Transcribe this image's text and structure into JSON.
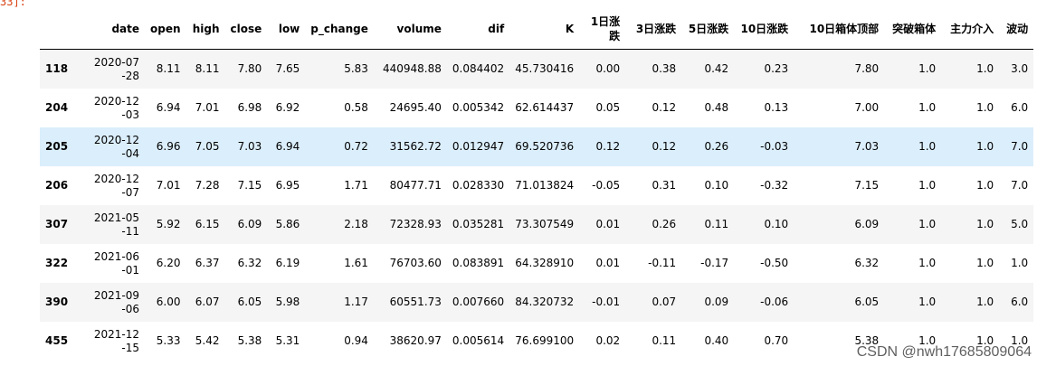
{
  "cell_prompt": "33]:",
  "table": {
    "index_header": "",
    "columns": [
      "date",
      "open",
      "high",
      "close",
      "low",
      "p_change",
      "volume",
      "dif",
      "K",
      "1日涨跌",
      "3日涨跌",
      "5日涨跌",
      "10日涨跌",
      "10日箱体顶部",
      "突破箱体",
      "主力介入",
      "波动"
    ],
    "rows": [
      {
        "index": "118",
        "cells": [
          "2020-07-28",
          "8.11",
          "8.11",
          "7.80",
          "7.65",
          "5.83",
          "440948.88",
          "0.084402",
          "45.730416",
          "0.00",
          "0.38",
          "0.42",
          "0.23",
          "7.80",
          "1.0",
          "1.0",
          "3.0"
        ]
      },
      {
        "index": "204",
        "cells": [
          "2020-12-03",
          "6.94",
          "7.01",
          "6.98",
          "6.92",
          "0.58",
          "24695.40",
          "0.005342",
          "62.614437",
          "0.05",
          "0.12",
          "0.48",
          "0.13",
          "7.00",
          "1.0",
          "1.0",
          "6.0"
        ]
      },
      {
        "index": "205",
        "cells": [
          "2020-12-04",
          "6.96",
          "7.05",
          "7.03",
          "6.94",
          "0.72",
          "31562.72",
          "0.012947",
          "69.520736",
          "0.12",
          "0.12",
          "0.26",
          "-0.03",
          "7.03",
          "1.0",
          "1.0",
          "7.0"
        ]
      },
      {
        "index": "206",
        "cells": [
          "2020-12-07",
          "7.01",
          "7.28",
          "7.15",
          "6.95",
          "1.71",
          "80477.71",
          "0.028330",
          "71.013824",
          "-0.05",
          "0.31",
          "0.10",
          "-0.32",
          "7.15",
          "1.0",
          "1.0",
          "7.0"
        ]
      },
      {
        "index": "307",
        "cells": [
          "2021-05-11",
          "5.92",
          "6.15",
          "6.09",
          "5.86",
          "2.18",
          "72328.93",
          "0.035281",
          "73.307549",
          "0.01",
          "0.26",
          "0.11",
          "0.10",
          "6.09",
          "1.0",
          "1.0",
          "5.0"
        ]
      },
      {
        "index": "322",
        "cells": [
          "2021-06-01",
          "6.20",
          "6.37",
          "6.32",
          "6.19",
          "1.61",
          "76703.60",
          "0.083891",
          "64.328910",
          "0.01",
          "-0.11",
          "-0.17",
          "-0.50",
          "6.32",
          "1.0",
          "1.0",
          "1.0"
        ]
      },
      {
        "index": "390",
        "cells": [
          "2021-09-06",
          "6.00",
          "6.07",
          "6.05",
          "5.98",
          "1.17",
          "60551.73",
          "0.007660",
          "84.320732",
          "-0.01",
          "0.07",
          "0.09",
          "-0.06",
          "6.05",
          "1.0",
          "1.0",
          "6.0"
        ]
      },
      {
        "index": "455",
        "cells": [
          "2021-12-15",
          "5.33",
          "5.42",
          "5.38",
          "5.31",
          "0.94",
          "38620.97",
          "0.005614",
          "76.699100",
          "0.02",
          "0.11",
          "0.40",
          "0.70",
          "5.38",
          "1.0",
          "1.0",
          "1.0"
        ]
      }
    ],
    "highlighted_row_index": "205"
  },
  "watermark": "CSDN @nwh17685809064",
  "colors": {
    "prompt": "#d84315",
    "row_stripe": "#f5f5f5",
    "row_hover": "#dbeefb"
  }
}
